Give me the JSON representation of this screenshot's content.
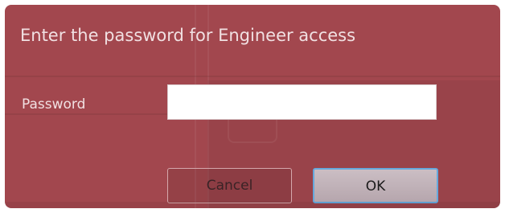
{
  "dialog": {
    "title": "Enter the password for Engineer access",
    "password_label": "Password",
    "password_value": "",
    "cancel_label": "Cancel",
    "ok_label": "OK"
  },
  "colors": {
    "dialog_background": "#a2474e",
    "text": "#f1e0e2",
    "ok_focus_border": "#66a8dc"
  }
}
